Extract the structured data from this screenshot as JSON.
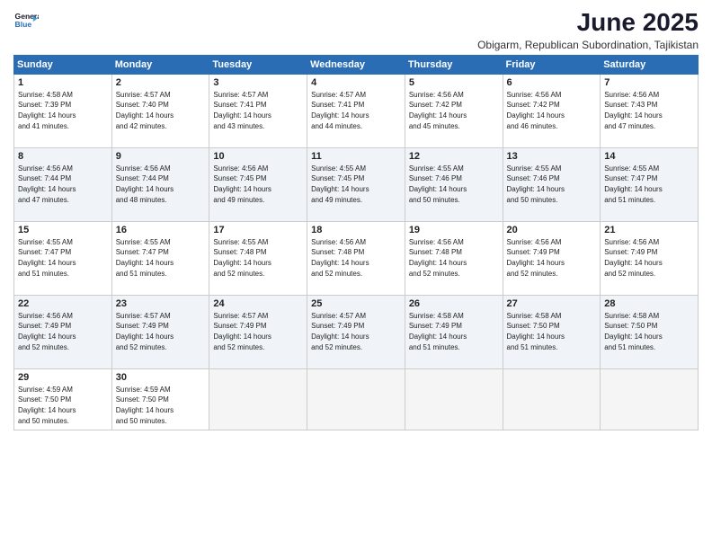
{
  "logo": {
    "line1": "General",
    "line2": "Blue"
  },
  "title": "June 2025",
  "subtitle": "Obigarm, Republican Subordination, Tajikistan",
  "days_header": [
    "Sunday",
    "Monday",
    "Tuesday",
    "Wednesday",
    "Thursday",
    "Friday",
    "Saturday"
  ],
  "weeks": [
    [
      {
        "num": "1",
        "info": "Sunrise: 4:58 AM\nSunset: 7:39 PM\nDaylight: 14 hours\nand 41 minutes."
      },
      {
        "num": "2",
        "info": "Sunrise: 4:57 AM\nSunset: 7:40 PM\nDaylight: 14 hours\nand 42 minutes."
      },
      {
        "num": "3",
        "info": "Sunrise: 4:57 AM\nSunset: 7:41 PM\nDaylight: 14 hours\nand 43 minutes."
      },
      {
        "num": "4",
        "info": "Sunrise: 4:57 AM\nSunset: 7:41 PM\nDaylight: 14 hours\nand 44 minutes."
      },
      {
        "num": "5",
        "info": "Sunrise: 4:56 AM\nSunset: 7:42 PM\nDaylight: 14 hours\nand 45 minutes."
      },
      {
        "num": "6",
        "info": "Sunrise: 4:56 AM\nSunset: 7:42 PM\nDaylight: 14 hours\nand 46 minutes."
      },
      {
        "num": "7",
        "info": "Sunrise: 4:56 AM\nSunset: 7:43 PM\nDaylight: 14 hours\nand 47 minutes."
      }
    ],
    [
      {
        "num": "8",
        "info": "Sunrise: 4:56 AM\nSunset: 7:44 PM\nDaylight: 14 hours\nand 47 minutes."
      },
      {
        "num": "9",
        "info": "Sunrise: 4:56 AM\nSunset: 7:44 PM\nDaylight: 14 hours\nand 48 minutes."
      },
      {
        "num": "10",
        "info": "Sunrise: 4:56 AM\nSunset: 7:45 PM\nDaylight: 14 hours\nand 49 minutes."
      },
      {
        "num": "11",
        "info": "Sunrise: 4:55 AM\nSunset: 7:45 PM\nDaylight: 14 hours\nand 49 minutes."
      },
      {
        "num": "12",
        "info": "Sunrise: 4:55 AM\nSunset: 7:46 PM\nDaylight: 14 hours\nand 50 minutes."
      },
      {
        "num": "13",
        "info": "Sunrise: 4:55 AM\nSunset: 7:46 PM\nDaylight: 14 hours\nand 50 minutes."
      },
      {
        "num": "14",
        "info": "Sunrise: 4:55 AM\nSunset: 7:47 PM\nDaylight: 14 hours\nand 51 minutes."
      }
    ],
    [
      {
        "num": "15",
        "info": "Sunrise: 4:55 AM\nSunset: 7:47 PM\nDaylight: 14 hours\nand 51 minutes."
      },
      {
        "num": "16",
        "info": "Sunrise: 4:55 AM\nSunset: 7:47 PM\nDaylight: 14 hours\nand 51 minutes."
      },
      {
        "num": "17",
        "info": "Sunrise: 4:55 AM\nSunset: 7:48 PM\nDaylight: 14 hours\nand 52 minutes."
      },
      {
        "num": "18",
        "info": "Sunrise: 4:56 AM\nSunset: 7:48 PM\nDaylight: 14 hours\nand 52 minutes."
      },
      {
        "num": "19",
        "info": "Sunrise: 4:56 AM\nSunset: 7:48 PM\nDaylight: 14 hours\nand 52 minutes."
      },
      {
        "num": "20",
        "info": "Sunrise: 4:56 AM\nSunset: 7:49 PM\nDaylight: 14 hours\nand 52 minutes."
      },
      {
        "num": "21",
        "info": "Sunrise: 4:56 AM\nSunset: 7:49 PM\nDaylight: 14 hours\nand 52 minutes."
      }
    ],
    [
      {
        "num": "22",
        "info": "Sunrise: 4:56 AM\nSunset: 7:49 PM\nDaylight: 14 hours\nand 52 minutes."
      },
      {
        "num": "23",
        "info": "Sunrise: 4:57 AM\nSunset: 7:49 PM\nDaylight: 14 hours\nand 52 minutes."
      },
      {
        "num": "24",
        "info": "Sunrise: 4:57 AM\nSunset: 7:49 PM\nDaylight: 14 hours\nand 52 minutes."
      },
      {
        "num": "25",
        "info": "Sunrise: 4:57 AM\nSunset: 7:49 PM\nDaylight: 14 hours\nand 52 minutes."
      },
      {
        "num": "26",
        "info": "Sunrise: 4:58 AM\nSunset: 7:49 PM\nDaylight: 14 hours\nand 51 minutes."
      },
      {
        "num": "27",
        "info": "Sunrise: 4:58 AM\nSunset: 7:50 PM\nDaylight: 14 hours\nand 51 minutes."
      },
      {
        "num": "28",
        "info": "Sunrise: 4:58 AM\nSunset: 7:50 PM\nDaylight: 14 hours\nand 51 minutes."
      }
    ],
    [
      {
        "num": "29",
        "info": "Sunrise: 4:59 AM\nSunset: 7:50 PM\nDaylight: 14 hours\nand 50 minutes."
      },
      {
        "num": "30",
        "info": "Sunrise: 4:59 AM\nSunset: 7:50 PM\nDaylight: 14 hours\nand 50 minutes."
      },
      {
        "num": "",
        "info": ""
      },
      {
        "num": "",
        "info": ""
      },
      {
        "num": "",
        "info": ""
      },
      {
        "num": "",
        "info": ""
      },
      {
        "num": "",
        "info": ""
      }
    ]
  ]
}
